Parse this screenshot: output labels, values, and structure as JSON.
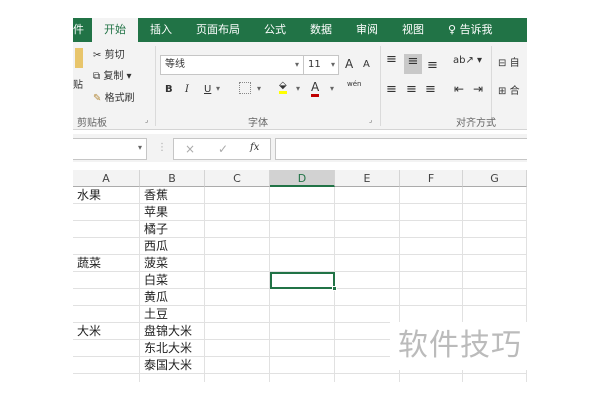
{
  "tabs": [
    "件",
    "开始",
    "插入",
    "页面布局",
    "公式",
    "数据",
    "审阅",
    "视图",
    "告诉我"
  ],
  "active_tab": "开始",
  "clipboard": {
    "paste": "贴",
    "cut": "剪切",
    "copy": "复制",
    "format_painter": "格式刷",
    "group": "剪贴板"
  },
  "font": {
    "name": "等线",
    "size": "11",
    "bold": "B",
    "italic": "I",
    "underline": "U",
    "grow": "A",
    "shrink": "A",
    "phonetic": "wén",
    "group": "字体"
  },
  "alignment": {
    "group": "对齐方式",
    "wrap": "自",
    "merge": "合"
  },
  "formula_bar": {
    "name_box": "",
    "fx": "fx",
    "cancel": "×",
    "enter": "✓",
    "value": ""
  },
  "columns": [
    "A",
    "B",
    "C",
    "D",
    "E",
    "F",
    "G"
  ],
  "selected_column": "D",
  "selected_cell": "D6",
  "rows": [
    [
      "水果",
      "香蕉"
    ],
    [
      "",
      "苹果"
    ],
    [
      "",
      "橘子"
    ],
    [
      "",
      "西瓜"
    ],
    [
      "蔬菜",
      "菠菜"
    ],
    [
      "",
      "白菜"
    ],
    [
      "",
      "黄瓜"
    ],
    [
      "",
      "土豆"
    ],
    [
      "大米",
      "盘锦大米"
    ],
    [
      "",
      "东北大米"
    ],
    [
      "",
      "泰国大米"
    ],
    [
      "",
      ""
    ]
  ],
  "watermark": "软件技巧",
  "colors": {
    "accent": "#217346",
    "font_color": "#c00000",
    "fill_color": "#ffff00"
  }
}
